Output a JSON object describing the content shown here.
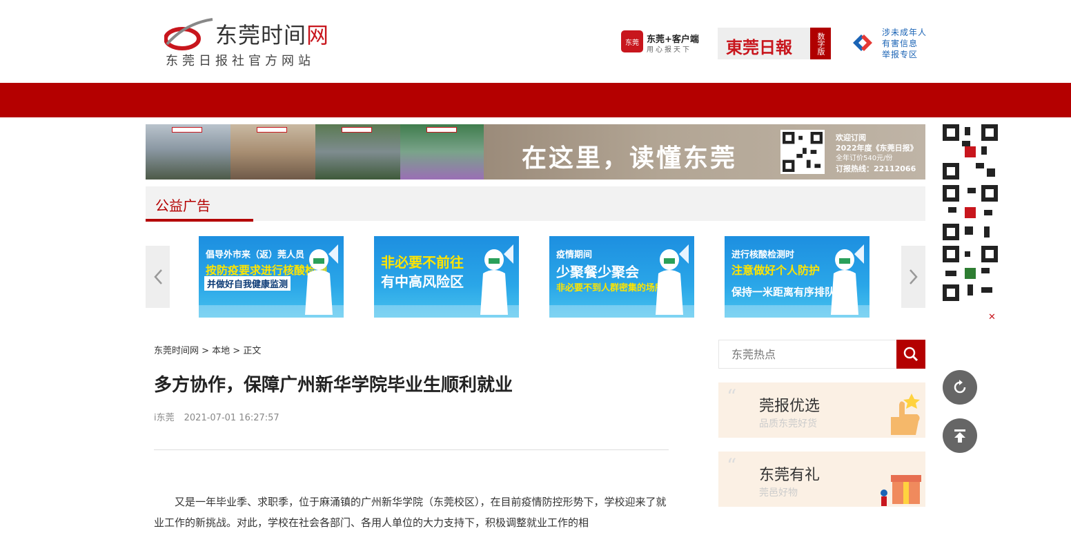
{
  "header": {
    "logo_text_main": "东莞时间",
    "logo_text_red": "网",
    "logo_sub": "东莞日报社官方网站",
    "app": {
      "badge": "东莞",
      "label": "东莞+客户端",
      "slogan": "用心报天下"
    },
    "paper": {
      "name": "東莞日報",
      "tag": "数字版"
    },
    "report": {
      "line1": "涉未成年人",
      "line2": "有害信息",
      "line3": "举报专区"
    }
  },
  "banner": {
    "slogan": "在这里，读懂东莞",
    "info_line1": "欢迎订阅",
    "info_line2": "2022年度《东莞日报》",
    "info_line3": "全年订价540元/份",
    "info_line4": "订报热线：22112066"
  },
  "public_ads": {
    "title": "公益广告",
    "prev_icon": "chevron-left-icon",
    "next_icon": "chevron-right-icon",
    "cards": [
      {
        "l1": "倡导外市来（返）莞人员",
        "l2": "按防疫要求进行核酸检测",
        "l3": "并做好自我健康监测"
      },
      {
        "l1": "",
        "l2": "非必要不前往",
        "l3": "有中高风险区"
      },
      {
        "l1": "疫情期间",
        "l2": "少聚餐少聚会",
        "l3": "非必要不到人群密集的场所"
      },
      {
        "l1": "进行核酸检测时",
        "l2": "注意做好个人防护",
        "l3": "保持一米距离有序排队"
      }
    ]
  },
  "side": {
    "close": "✕"
  },
  "article": {
    "breadcrumb": "东莞时间网 > 本地 > 正文",
    "title": "多方协作，保障广州新华学院毕业生顺利就业",
    "source": "i东莞",
    "time": "2021-07-01 16:27:57",
    "body": "又是一年毕业季、求职季，位于麻涌镇的广州新华学院（东莞校区），在目前疫情防控形势下，学校迎来了就业工作的新挑战。对此，学校在社会各部门、各用人单位的大力支持下，积极调整就业工作的相"
  },
  "sidebar": {
    "search_placeholder": "东莞热点",
    "promos": [
      {
        "title": "莞报优选",
        "sub": "品质东莞好货"
      },
      {
        "title": "东莞有礼",
        "sub": "莞邑好物"
      }
    ]
  },
  "colors": {
    "brand_red": "#b40000",
    "accent_red": "#c8161d",
    "link_blue": "#1a63b5"
  }
}
